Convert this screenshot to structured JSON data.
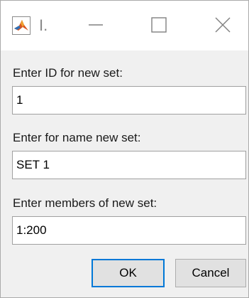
{
  "window": {
    "title": "I.",
    "app_icon": "matlab-icon"
  },
  "form": {
    "id_label": "Enter ID for new set:",
    "id_value": "1",
    "name_label": "Enter for name new set:",
    "name_value": "SET 1",
    "members_label": "Enter members of new set:",
    "members_value": "1:200"
  },
  "buttons": {
    "ok_label": "OK",
    "cancel_label": "Cancel"
  },
  "colors": {
    "focus_border": "#0078d7",
    "dialog_background": "#f0f0f0"
  }
}
